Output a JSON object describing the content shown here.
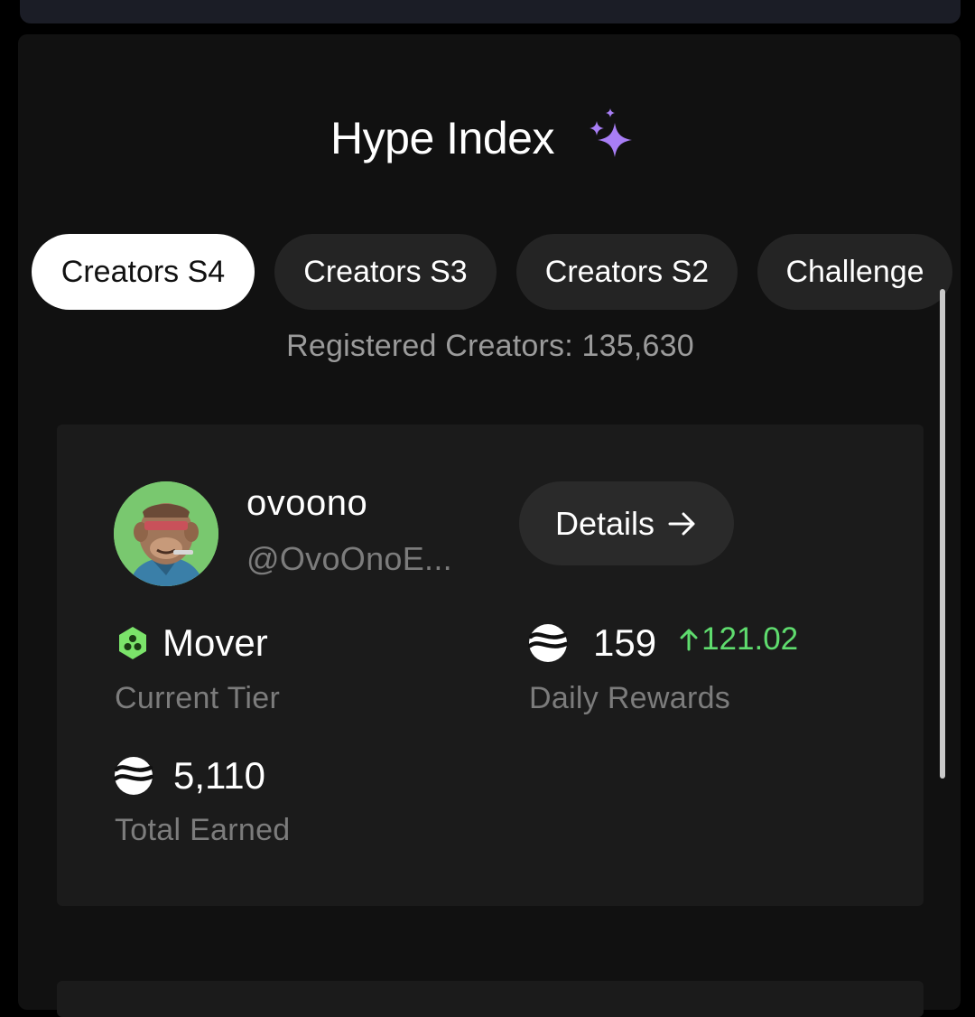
{
  "header": {
    "title": "Hype Index",
    "title_icon": "sparkle-icon"
  },
  "tabs": [
    {
      "label": "Creators S4",
      "active": true
    },
    {
      "label": "Creators S3",
      "active": false
    },
    {
      "label": "Creators S2",
      "active": false
    },
    {
      "label": "Challenge",
      "active": false
    }
  ],
  "registered_creators": "Registered Creators: 135,630",
  "profile": {
    "name": "ovoono",
    "handle": "@OvoOnoE...",
    "details_label": "Details",
    "details_icon": "arrow-right-icon"
  },
  "stats": {
    "tier": {
      "value": "Mover",
      "label": "Current Tier",
      "icon": "hexagon-tier-icon"
    },
    "daily_rewards": {
      "value": "159",
      "change": "121.02",
      "label": "Daily Rewards",
      "icon": "token-icon"
    },
    "total_earned": {
      "value": "5,110",
      "label": "Total Earned",
      "icon": "token-icon"
    }
  },
  "colors": {
    "background": "#111111",
    "card": "#1b1b1b",
    "accent_sparkle": "#a87ef5",
    "positive_change": "#5fdc6e",
    "tier_green": "#7be36a",
    "muted_text": "#7c7c7c"
  }
}
